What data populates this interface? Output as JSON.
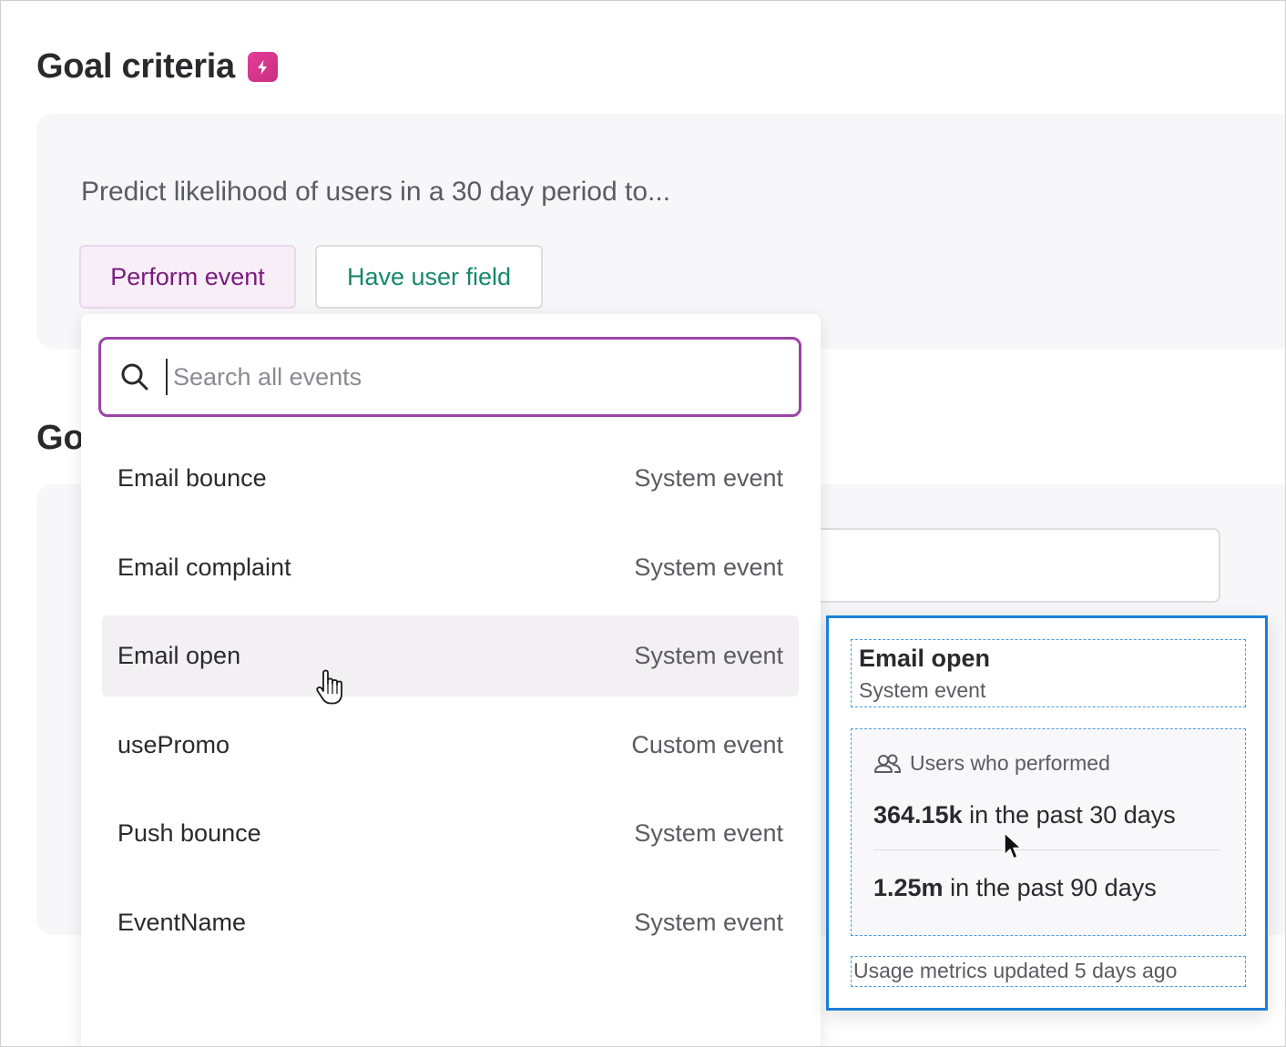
{
  "header": {
    "title": "Goal criteria",
    "second_title_partial": "Go"
  },
  "criteria": {
    "prompt": "Predict likelihood of users in a 30 day period to...",
    "perform_event_label": "Perform event",
    "have_user_field_label": "Have user field"
  },
  "search": {
    "placeholder": "Search all events",
    "value": ""
  },
  "events": [
    {
      "name": "Email bounce",
      "type": "System event"
    },
    {
      "name": "Email complaint",
      "type": "System event"
    },
    {
      "name": "Email open",
      "type": "System event"
    },
    {
      "name": "usePromo",
      "type": "Custom event"
    },
    {
      "name": "Push bounce",
      "type": "System event"
    },
    {
      "name": "EventName",
      "type": "System event"
    }
  ],
  "hovered_event_index": 2,
  "details_card": {
    "title": "Email open",
    "subtitle": "System event",
    "users_label": "Users who performed",
    "stat_30_value": "364.15k",
    "stat_30_suffix": " in the past 30 days",
    "stat_90_value": "1.25m",
    "stat_90_suffix": " in the past 90 days",
    "footer": "Usage metrics updated 5 days ago"
  },
  "colors": {
    "accent_purple": "#9a45a6",
    "perform_text": "#7a1b7e",
    "field_text": "#16876a",
    "badge_pink": "#e23c9a",
    "card_border": "#1a7fd8"
  }
}
